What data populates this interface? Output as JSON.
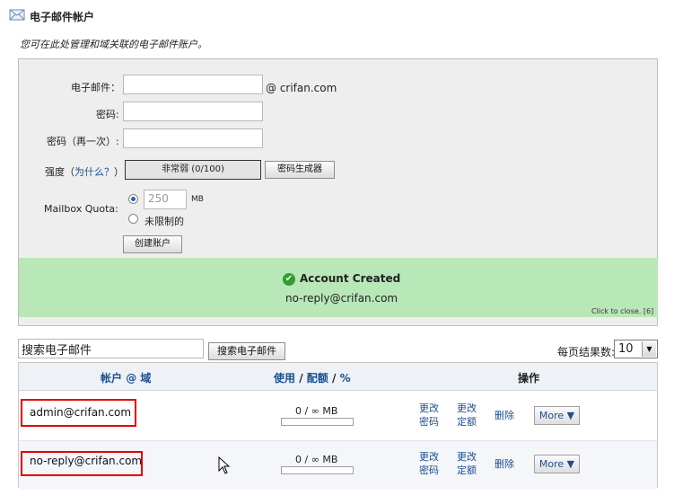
{
  "header": {
    "title": "电子邮件帐户",
    "description": "您可在此处管理和域关联的电子邮件账户。"
  },
  "form": {
    "email_label": "电子邮件：",
    "email_value": "",
    "domain_suffix": "@ crifan.com",
    "password_label": "密码:",
    "password_value": "",
    "password_again_label": "密码（再一次）:",
    "password_again_value": "",
    "strength_label_prefix": "强度（",
    "strength_why_link": "为什么？",
    "strength_label_suffix": "）:",
    "strength_value": "非常弱 (0/100)",
    "generator_button": "密码生成器",
    "quota_label": "Mailbox Quota:",
    "quota_value": "250",
    "quota_unit": "MB",
    "quota_unlimited_label": "未限制的",
    "quota_selected": "250",
    "create_button": "创建账户"
  },
  "notice": {
    "title": "Account Created",
    "email": "no-reply@crifan.com",
    "close_text": "Click to close. [6]",
    "bg_color": "#b8e7b8"
  },
  "search": {
    "value": "搜索电子邮件",
    "button": "搜索电子邮件",
    "per_page_label": "每页结果数:",
    "per_page_value": "10"
  },
  "table": {
    "headers": {
      "account": "帐户",
      "at": "@",
      "domain": "域",
      "usage": "使用",
      "slash1": "/",
      "quota": "配额",
      "slash2": "/",
      "percent": "%",
      "actions": "操作"
    },
    "rows": [
      {
        "account": "admin@crifan.com",
        "usage": "0 / ∞ MB",
        "change_password_1": "更改",
        "change_password_2": "密码",
        "change_quota_1": "更改",
        "change_quota_2": "定额",
        "delete": "删除",
        "more": "More ▼",
        "highlighted": true
      },
      {
        "account": "no-reply@crifan.com",
        "usage": "0 / ∞ MB",
        "change_password_1": "更改",
        "change_password_2": "密码",
        "change_quota_1": "更改",
        "change_quota_2": "定额",
        "delete": "删除",
        "more": "More ▼",
        "highlighted": true
      }
    ]
  },
  "colors": {
    "link": "#1a4f91",
    "highlight": "#e00000",
    "success": "#2f9e2f"
  }
}
